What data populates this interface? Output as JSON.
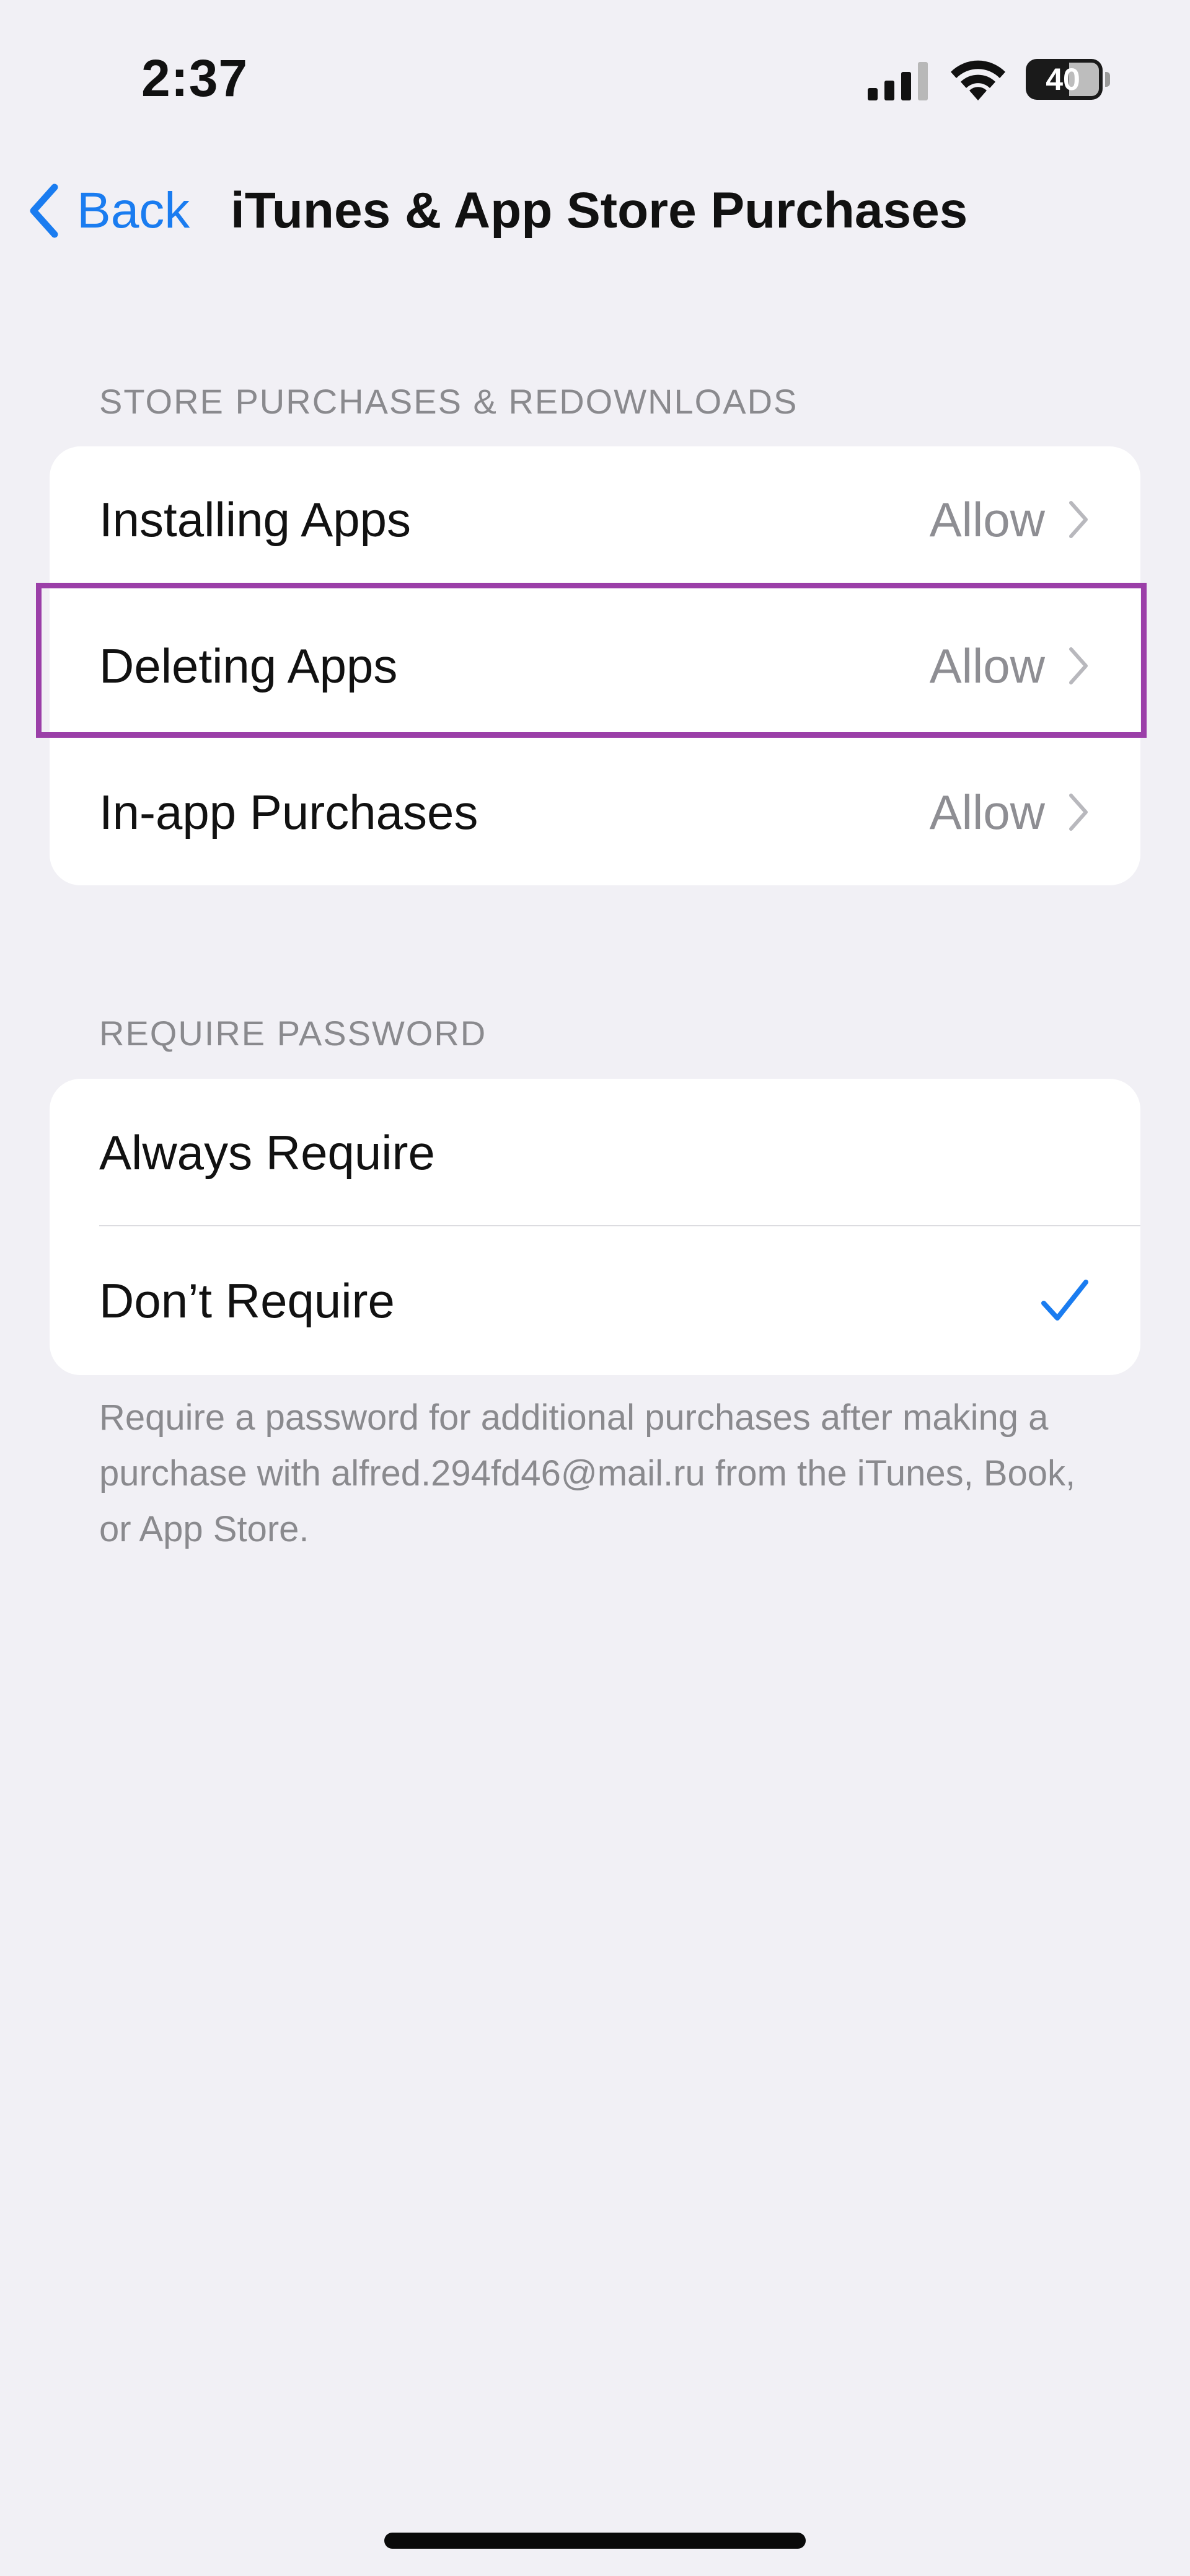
{
  "status_bar": {
    "time": "2:37",
    "battery_level": "40"
  },
  "nav": {
    "back_label": "Back",
    "title": "iTunes & App Store Purchases"
  },
  "store_section": {
    "header": "STORE PURCHASES & REDOWNLOADS",
    "rows": [
      {
        "label": "Installing Apps",
        "value": "Allow"
      },
      {
        "label": "Deleting Apps",
        "value": "Allow"
      },
      {
        "label": "In-app Purchases",
        "value": "Allow"
      }
    ],
    "highlighted_row": "Deleting Apps"
  },
  "password_section": {
    "header": "REQUIRE PASSWORD",
    "rows": [
      {
        "label": "Always Require",
        "selected": false
      },
      {
        "label": "Don’t Require",
        "selected": true
      }
    ],
    "footer": "Require a password for additional purchases after making a purchase with alfred.294fd46@mail.ru from the iTunes, Book, or App Store."
  },
  "colors": {
    "accent": "#1a7cf0",
    "highlight": "#9b3fa8",
    "background": "#f1f0f5"
  },
  "icons": [
    "signal-icon",
    "wifi-icon",
    "battery-icon",
    "back-chevron-icon",
    "chevron-right-icon",
    "checkmark-icon"
  ]
}
